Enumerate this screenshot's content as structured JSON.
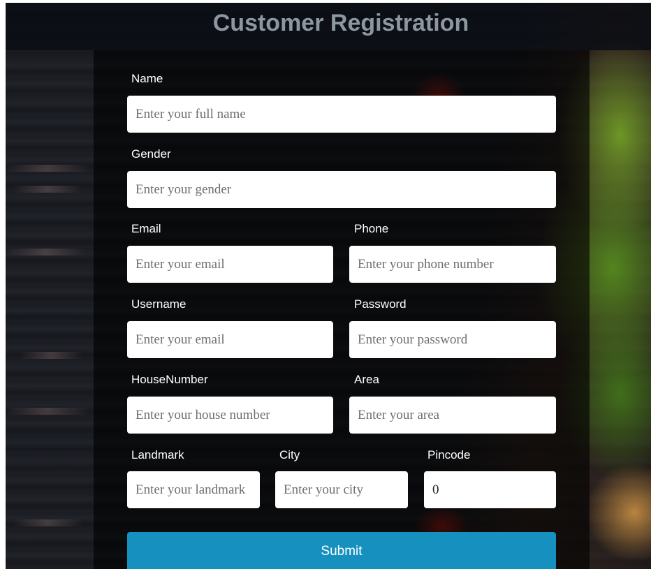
{
  "page": {
    "title": "Customer Registration",
    "accent_color": "#1690bf"
  },
  "form": {
    "name": {
      "label": "Name",
      "placeholder": "Enter your full name",
      "value": ""
    },
    "gender": {
      "label": "Gender",
      "placeholder": "Enter your gender",
      "value": ""
    },
    "email": {
      "label": "Email",
      "placeholder": "Enter your email",
      "value": ""
    },
    "phone": {
      "label": "Phone",
      "placeholder": "Enter your phone number",
      "value": ""
    },
    "username": {
      "label": "Username",
      "placeholder": "Enter your email",
      "value": ""
    },
    "password": {
      "label": "Password",
      "placeholder": "Enter your password",
      "value": ""
    },
    "house_number": {
      "label": "HouseNumber",
      "placeholder": "Enter your house number",
      "value": ""
    },
    "area": {
      "label": "Area",
      "placeholder": "Enter your area",
      "value": ""
    },
    "landmark": {
      "label": "Landmark",
      "placeholder": "Enter your landmark",
      "value": ""
    },
    "city": {
      "label": "City",
      "placeholder": "Enter your city",
      "value": ""
    },
    "pincode": {
      "label": "Pincode",
      "placeholder": "",
      "value": "0"
    },
    "submit_label": "Submit"
  }
}
